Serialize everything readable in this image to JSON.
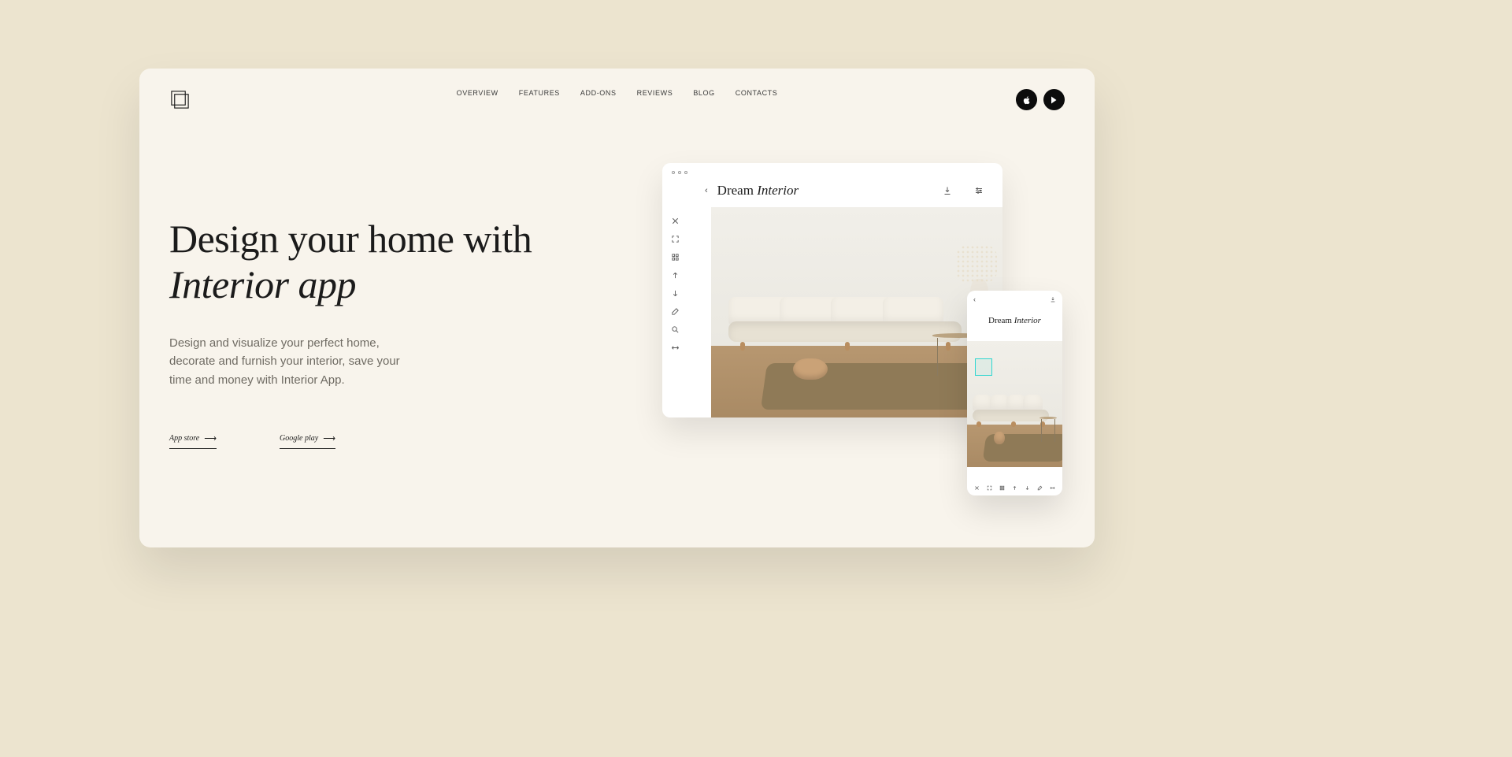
{
  "nav": {
    "items": [
      "OVERVIEW",
      "FEATURES",
      "ADD-ONS",
      "REVIEWS",
      "BLOG",
      "CONTACTS"
    ]
  },
  "hero": {
    "title_plain": "Design your home with ",
    "title_italic": "Interior app",
    "subtitle": "Design and visualize your perfect home, decorate and furnish your interior, save your time and money with Interior App.",
    "cta1": "App store",
    "cta2": "Google play",
    "arrow": "⟶"
  },
  "desk": {
    "title_plain": "Dream ",
    "title_italic": "Interior"
  },
  "mob": {
    "title_plain": "Dream ",
    "title_italic": "Interior"
  }
}
